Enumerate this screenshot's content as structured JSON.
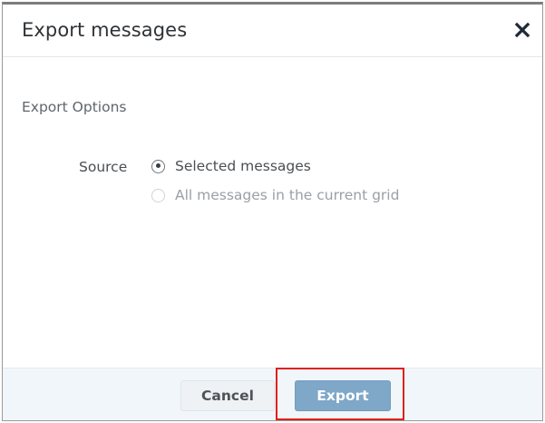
{
  "dialog": {
    "title": "Export messages",
    "close_icon": "close-icon"
  },
  "options": {
    "section_title": "Export Options",
    "source_label": "Source",
    "choices": [
      {
        "label": "Selected messages",
        "checked": true,
        "disabled": false
      },
      {
        "label": "All messages in the current grid",
        "checked": false,
        "disabled": true
      }
    ]
  },
  "footer": {
    "cancel_label": "Cancel",
    "export_label": "Export"
  },
  "colors": {
    "export_button": "#7fa7c8",
    "highlight": "#e0201b",
    "footer_bg": "#f0f6f9"
  }
}
